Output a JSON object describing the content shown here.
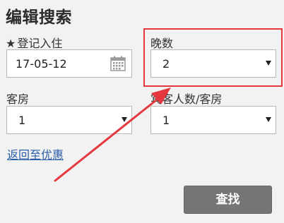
{
  "form": {
    "title": "编辑搜索",
    "checkin": {
      "required_mark": "★",
      "label": "登记入住",
      "value": "17-05-12",
      "icon": "calendar-icon"
    },
    "nights": {
      "label": "晚数",
      "value": "2"
    },
    "rooms": {
      "label": "客房",
      "value": "1"
    },
    "guests": {
      "label": "宾客人数/客房",
      "value": "1"
    },
    "back_link": "返回至优惠",
    "search_button": "查找"
  },
  "annotation": {
    "color": "#e5373e"
  }
}
